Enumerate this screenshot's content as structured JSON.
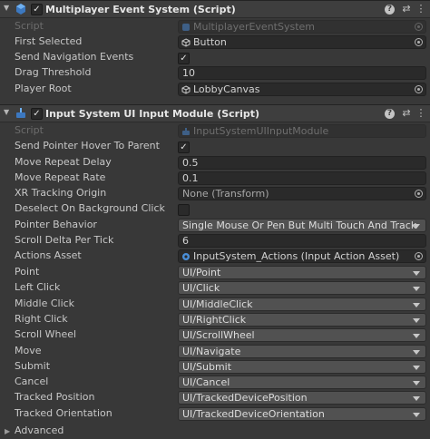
{
  "component1": {
    "title": "Multiplayer Event System (Script)",
    "enabled_check": "✓",
    "fields": {
      "script_label": "Script",
      "script_value": "MultiplayerEventSystem",
      "first_selected_label": "First Selected",
      "first_selected_value": "Button",
      "send_nav_label": "Send Navigation Events",
      "send_nav_check": "✓",
      "drag_threshold_label": "Drag Threshold",
      "drag_threshold_value": "10",
      "player_root_label": "Player Root",
      "player_root_value": "LobbyCanvas"
    }
  },
  "component2": {
    "title": "Input System UI Input Module (Script)",
    "enabled_check": "✓",
    "fields": {
      "script_label": "Script",
      "script_value": "InputSystemUIInputModule",
      "hover_parent_label": "Send Pointer Hover To Parent",
      "hover_parent_check": "✓",
      "repeat_delay_label": "Move Repeat Delay",
      "repeat_delay_value": "0.5",
      "repeat_rate_label": "Move Repeat Rate",
      "repeat_rate_value": "0.1",
      "xr_origin_label": "XR Tracking Origin",
      "xr_origin_value": "None (Transform)",
      "deselect_label": "Deselect On Background Click",
      "pointer_behavior_label": "Pointer Behavior",
      "pointer_behavior_value": "Single Mouse Or Pen But Multi Touch And Track",
      "scroll_delta_label": "Scroll Delta Per Tick",
      "scroll_delta_value": "6",
      "actions_asset_label": "Actions Asset",
      "actions_asset_value": "InputSystem_Actions (Input Action Asset)"
    },
    "actions": [
      {
        "label": "Point",
        "value": "UI/Point"
      },
      {
        "label": "Left Click",
        "value": "UI/Click"
      },
      {
        "label": "Middle Click",
        "value": "UI/MiddleClick"
      },
      {
        "label": "Right Click",
        "value": "UI/RightClick"
      },
      {
        "label": "Scroll Wheel",
        "value": "UI/ScrollWheel"
      },
      {
        "label": "Move",
        "value": "UI/Navigate"
      },
      {
        "label": "Submit",
        "value": "UI/Submit"
      },
      {
        "label": "Cancel",
        "value": "UI/Cancel"
      },
      {
        "label": "Tracked Position",
        "value": "UI/TrackedDevicePosition"
      },
      {
        "label": "Tracked Orientation",
        "value": "UI/TrackedDeviceOrientation"
      }
    ],
    "advanced_label": "Advanced"
  },
  "header_buttons": {
    "help": "?",
    "presets": "⇄",
    "menu": "⋮"
  },
  "icons": {
    "foldout": "foldout-arrow-icon",
    "script": "script-icon",
    "gameobject": "gameobject-cube-icon",
    "picker": "object-picker-icon",
    "dropdown": "dropdown-arrow-icon"
  },
  "colors": {
    "background": "#383838",
    "header": "#3e3e3e",
    "field": "#2a2a2a",
    "dropdown": "#515151",
    "script_icon_blue": "#4a8fd8"
  }
}
